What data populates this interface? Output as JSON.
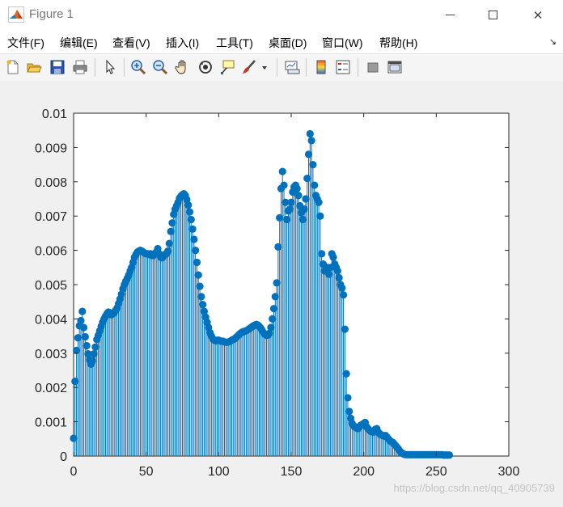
{
  "window": {
    "title": "Figure 1",
    "minimize_icon": "minimize-icon",
    "maximize_icon": "maximize-icon",
    "close_icon": "close-icon"
  },
  "menu": {
    "items": [
      {
        "label": "文件(F)",
        "name": "menu-file"
      },
      {
        "label": "编辑(E)",
        "name": "menu-edit"
      },
      {
        "label": "查看(V)",
        "name": "menu-view"
      },
      {
        "label": "插入(I)",
        "name": "menu-insert"
      },
      {
        "label": "工具(T)",
        "name": "menu-tools"
      },
      {
        "label": "桌面(D)",
        "name": "menu-desktop"
      },
      {
        "label": "窗口(W)",
        "name": "menu-window"
      },
      {
        "label": "帮助(H)",
        "name": "menu-help"
      }
    ],
    "dock_arrow": "↘"
  },
  "toolbar": {
    "icons": [
      "new-figure-icon",
      "open-file-icon",
      "save-icon",
      "print-icon",
      "pointer-icon",
      "zoom-in-icon",
      "zoom-out-icon",
      "pan-icon",
      "rotate-3d-icon",
      "data-cursor-icon",
      "brush-icon",
      "brush-dropdown-icon",
      "link-plot-icon",
      "colorbar-icon",
      "legend-icon",
      "hide-plot-tools-icon",
      "show-plot-tools-icon"
    ]
  },
  "watermark": "https://blog.csdn.net/qq_40905739",
  "chart_data": {
    "type": "stem",
    "title": "",
    "xlabel": "",
    "ylabel": "",
    "xlim": [
      0,
      300
    ],
    "ylim": [
      0,
      0.01
    ],
    "xticks": [
      0,
      50,
      100,
      150,
      200,
      250,
      300
    ],
    "yticks": [
      0,
      0.001,
      0.002,
      0.003,
      0.004,
      0.005,
      0.006,
      0.007,
      0.008,
      0.009,
      0.01
    ],
    "xtick_labels": [
      "0",
      "50",
      "100",
      "150",
      "200",
      "250",
      "300"
    ],
    "ytick_labels": [
      "0",
      "0.001",
      "0.002",
      "0.003",
      "0.004",
      "0.005",
      "0.006",
      "0.007",
      "0.008",
      "0.009",
      "0.01"
    ],
    "grid": false,
    "color": "#0072bd",
    "x_start": 0,
    "x_step": 1,
    "values": [
      0.00052,
      0.00218,
      0.00308,
      0.00345,
      0.0038,
      0.00395,
      0.00422,
      0.00375,
      0.00348,
      0.00322,
      0.00298,
      0.0028,
      0.00268,
      0.00278,
      0.00298,
      0.00318,
      0.0034,
      0.00352,
      0.00365,
      0.00378,
      0.0039,
      0.004,
      0.00408,
      0.00415,
      0.0042,
      0.00418,
      0.00412,
      0.00415,
      0.00418,
      0.00425,
      0.00432,
      0.00445,
      0.00458,
      0.00472,
      0.00488,
      0.005,
      0.0051,
      0.00518,
      0.00528,
      0.0054,
      0.0055,
      0.00565,
      0.0058,
      0.00588,
      0.00595,
      0.00598,
      0.006,
      0.00598,
      0.00595,
      0.00592,
      0.0059,
      0.0059,
      0.00588,
      0.0059,
      0.00585,
      0.00585,
      0.0059,
      0.00595,
      0.00605,
      0.0059,
      0.0058,
      0.00578,
      0.00582,
      0.00588,
      0.0059,
      0.00598,
      0.0062,
      0.00655,
      0.0068,
      0.00705,
      0.0072,
      0.0073,
      0.0074,
      0.00752,
      0.00758,
      0.00762,
      0.00765,
      0.0076,
      0.00748,
      0.00732,
      0.00712,
      0.0069,
      0.00662,
      0.00632,
      0.006,
      0.00565,
      0.00528,
      0.00495,
      0.00465,
      0.00442,
      0.00422,
      0.00405,
      0.0039,
      0.00375,
      0.0036,
      0.0035,
      0.00342,
      0.00338,
      0.00336,
      0.00338,
      0.00338,
      0.00336,
      0.00335,
      0.00335,
      0.00333,
      0.00332,
      0.00332,
      0.00333,
      0.00335,
      0.00338,
      0.0034,
      0.00342,
      0.00346,
      0.0035,
      0.00354,
      0.00358,
      0.00361,
      0.00363,
      0.00364,
      0.00366,
      0.00368,
      0.00371,
      0.00374,
      0.00377,
      0.0038,
      0.00382,
      0.00384,
      0.00382,
      0.00378,
      0.00373,
      0.00366,
      0.00359,
      0.00355,
      0.00352,
      0.00353,
      0.00358,
      0.00375,
      0.004,
      0.0043,
      0.00465,
      0.00505,
      0.0061,
      0.00695,
      0.0078,
      0.0083,
      0.0079,
      0.0074,
      0.0069,
      0.00715,
      0.0072,
      0.0074,
      0.0077,
      0.00785,
      0.0079,
      0.0078,
      0.0076,
      0.0073,
      0.0071,
      0.0069,
      0.0072,
      0.0075,
      0.0081,
      0.0088,
      0.0094,
      0.0092,
      0.0085,
      0.0079,
      0.0076,
      0.0075,
      0.0074,
      0.007,
      0.0059,
      0.0056,
      0.0054,
      0.0054,
      0.0055,
      0.0053,
      0.0055,
      0.0059,
      0.0058,
      0.0056,
      0.0055,
      0.0054,
      0.0052,
      0.005,
      0.0049,
      0.0047,
      0.0037,
      0.0024,
      0.0017,
      0.0013,
      0.0011,
      0.00095,
      0.00088,
      0.00085,
      0.00082,
      0.0008,
      0.00085,
      0.0009,
      0.00092,
      0.00095,
      0.00098,
      0.00085,
      0.0008,
      0.00075,
      0.00072,
      0.0007,
      0.0007,
      0.00078,
      0.0008,
      0.0007,
      0.00065,
      0.00062,
      0.0006,
      0.00058,
      0.0006,
      0.00055,
      0.0005,
      0.00045,
      0.00042,
      0.0004,
      0.00035,
      0.0003,
      0.00025,
      0.0002,
      0.00014,
      0.0001,
      7e-05,
      5e-05,
      4e-05,
      4e-05,
      4e-05,
      4e-05,
      4e-05,
      4e-05,
      4e-05,
      4e-05,
      4e-05,
      4e-05,
      4e-05,
      4e-05,
      4e-05,
      4e-05,
      4e-05,
      4e-05,
      4e-05,
      4e-05,
      4e-05,
      4e-05,
      4e-05,
      4e-05,
      4e-05,
      4e-05,
      4e-05,
      4e-05,
      3e-05,
      3e-05,
      3e-05,
      3e-05,
      3e-05
    ]
  }
}
